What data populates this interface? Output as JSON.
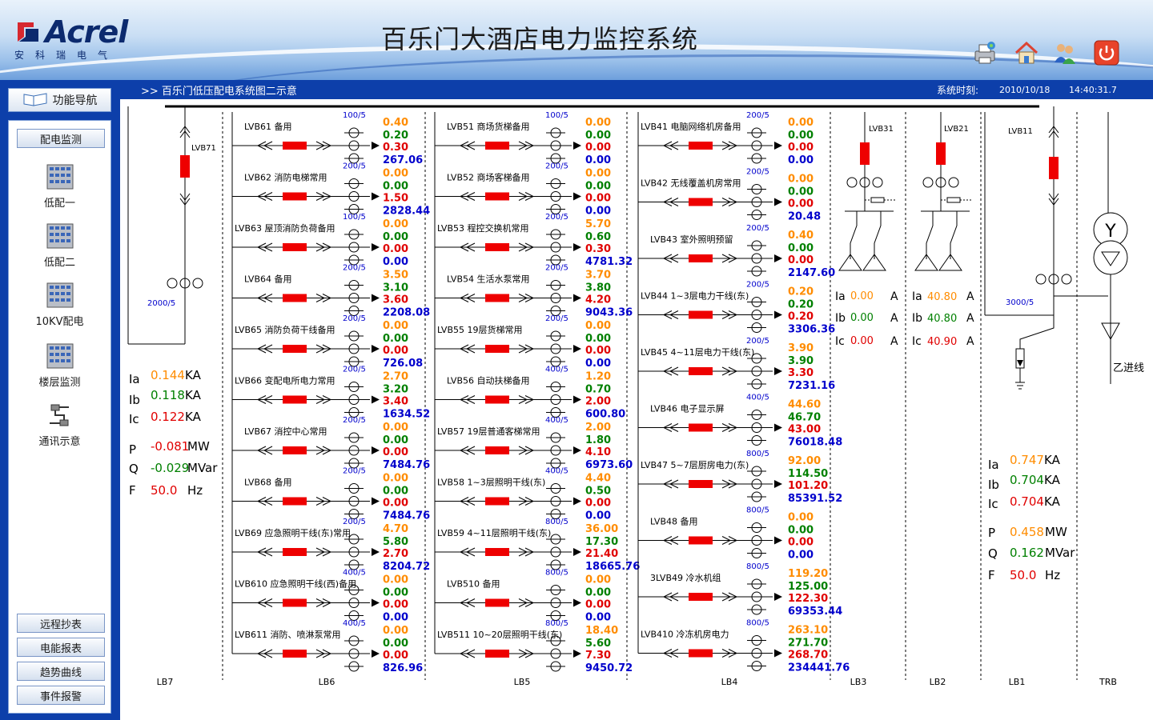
{
  "header": {
    "title": "百乐门大酒店电力监控系统",
    "logo_text": "Acrel",
    "logo_sub": "安科瑞电气",
    "toolbar_icons": [
      "printer-icon",
      "home-icon",
      "users-icon",
      "power-icon"
    ]
  },
  "nav": {
    "breadcrumb": ">>  百乐门低压配电系统图二示意",
    "time_label": "系统时刻:",
    "date": "2010/10/18",
    "time": "14:40:31.7"
  },
  "sidebar": {
    "func_nav_label": "功能导航",
    "section_label": "配电监测",
    "items": [
      {
        "label": "低配一",
        "icon": "switchgear-icon"
      },
      {
        "label": "低配二",
        "icon": "switchgear-icon"
      },
      {
        "label": "10KV配电",
        "icon": "switchgear-icon"
      },
      {
        "label": "楼层监测",
        "icon": "switchgear-icon"
      },
      {
        "label": "通讯示意",
        "icon": "communication-icon"
      }
    ],
    "bottom_buttons": [
      "远程抄表",
      "电能报表",
      "趋势曲线",
      "事件报警"
    ]
  },
  "colors": {
    "ia": "#ff8c00",
    "ib": "#008000",
    "ic": "#e00000",
    "energy": "#0000cc",
    "breaker": "#ee0000",
    "label": "#000000"
  },
  "cabinets": [
    {
      "id": "LB7"
    },
    {
      "id": "LB6"
    },
    {
      "id": "LB5"
    },
    {
      "id": "LB4"
    },
    {
      "id": "LB3"
    },
    {
      "id": "LB2"
    },
    {
      "id": "LB1"
    },
    {
      "id": "TRB"
    }
  ],
  "columns": [
    {
      "feeders": [
        {
          "name": "LVB61 备用",
          "ct": "100/5",
          "ia": "0.40",
          "ib": "0.20",
          "ic": "0.30",
          "e": "267.06"
        },
        {
          "name": "LVB62 消防电梯常用",
          "ct": "200/5",
          "ia": "0.00",
          "ib": "0.00",
          "ic": "1.50",
          "e": "2828.44"
        },
        {
          "name": "LVB63 屋顶消防负荷备用",
          "ct": "100/5",
          "ia": "0.00",
          "ib": "0.00",
          "ic": "0.00",
          "e": "0.00"
        },
        {
          "name": "LVB64 备用",
          "ct": "200/5",
          "ia": "3.50",
          "ib": "3.10",
          "ic": "3.60",
          "e": "2208.08"
        },
        {
          "name": "LVB65 消防负荷干线备用",
          "ct": "200/5",
          "ia": "0.00",
          "ib": "0.00",
          "ic": "0.00",
          "e": "726.08"
        },
        {
          "name": "LVB66 变配电所电力常用",
          "ct": "200/5",
          "ia": "2.70",
          "ib": "3.20",
          "ic": "3.40",
          "e": "1634.52"
        },
        {
          "name": "LVB67 消控中心常用",
          "ct": "200/5",
          "ia": "0.00",
          "ib": "0.00",
          "ic": "0.00",
          "e": "7484.76"
        },
        {
          "name": "LVB68 备用",
          "ct": "200/5",
          "ia": "0.00",
          "ib": "0.00",
          "ic": "0.00",
          "e": "7484.76"
        },
        {
          "name": "LVB69 应急照明干线(东)常用",
          "ct": "200/5",
          "ia": "4.70",
          "ib": "5.80",
          "ic": "2.70",
          "e": "8204.72"
        },
        {
          "name": "LVB610 应急照明干线(西)备用",
          "ct": "400/5",
          "ia": "0.00",
          "ib": "0.00",
          "ic": "0.00",
          "e": "0.00"
        },
        {
          "name": "LVB611 消防、喷淋泵常用",
          "ct": "400/5",
          "ia": "0.00",
          "ib": "0.00",
          "ic": "0.00",
          "e": "826.96"
        }
      ]
    },
    {
      "feeders": [
        {
          "name": "LVB51 商场货梯备用",
          "ct": "100/5",
          "ia": "0.00",
          "ib": "0.00",
          "ic": "0.00",
          "e": "0.00"
        },
        {
          "name": "LVB52 商场客梯备用",
          "ct": "200/5",
          "ia": "0.00",
          "ib": "0.00",
          "ic": "0.00",
          "e": "0.00"
        },
        {
          "name": "LVB53 程控交换机常用",
          "ct": "200/5",
          "ia": "5.70",
          "ib": "0.60",
          "ic": "0.30",
          "e": "4781.32"
        },
        {
          "name": "LVB54 生活水泵常用",
          "ct": "200/5",
          "ia": "3.70",
          "ib": "3.80",
          "ic": "4.20",
          "e": "9043.36"
        },
        {
          "name": "LVB55 19层货梯常用",
          "ct": "200/5",
          "ia": "0.00",
          "ib": "0.00",
          "ic": "0.00",
          "e": "0.00"
        },
        {
          "name": "LVB56 自动扶梯备用",
          "ct": "400/5",
          "ia": "1.20",
          "ib": "0.70",
          "ic": "2.00",
          "e": "600.80"
        },
        {
          "name": "LVB57 19层普通客梯常用",
          "ct": "400/5",
          "ia": "2.00",
          "ib": "1.80",
          "ic": "4.10",
          "e": "6973.60"
        },
        {
          "name": "LVB58 1~3层照明干线(东)",
          "ct": "400/5",
          "ia": "4.40",
          "ib": "0.50",
          "ic": "0.00",
          "e": "0.00"
        },
        {
          "name": "LVB59 4~11层照明干线(东)",
          "ct": "800/5",
          "ia": "36.00",
          "ib": "17.30",
          "ic": "21.40",
          "e": "18665.76"
        },
        {
          "name": "LVB510 备用",
          "ct": "800/5",
          "ia": "0.00",
          "ib": "0.00",
          "ic": "0.00",
          "e": "0.00"
        },
        {
          "name": "LVB511 10~20层照明干线(东)",
          "ct": "800/5",
          "ia": "18.40",
          "ib": "5.60",
          "ic": "7.30",
          "e": "9450.72"
        }
      ]
    },
    {
      "feeders": [
        {
          "name": "LVB41 电脑网络机房备用",
          "ct": "200/5",
          "ia": "0.00",
          "ib": "0.00",
          "ic": "0.00",
          "e": "0.00"
        },
        {
          "name": "LVB42 无线覆盖机房常用",
          "ct": "200/5",
          "ia": "0.00",
          "ib": "0.00",
          "ic": "0.00",
          "e": "20.48"
        },
        {
          "name": "LVB43 室外照明预留",
          "ct": "200/5",
          "ia": "0.40",
          "ib": "0.00",
          "ic": "0.00",
          "e": "2147.60"
        },
        {
          "name": "LVB44 1~3层电力干线(东)",
          "ct": "200/5",
          "ia": "0.20",
          "ib": "0.20",
          "ic": "0.20",
          "e": "3306.36"
        },
        {
          "name": "LVB45 4~11层电力干线(东)",
          "ct": "200/5",
          "ia": "3.90",
          "ib": "3.90",
          "ic": "3.30",
          "e": "7231.16"
        },
        {
          "name": "LVB46 电子显示屏",
          "ct": "400/5",
          "ia": "44.60",
          "ib": "46.70",
          "ic": "43.00",
          "e": "76018.48"
        },
        {
          "name": "LVB47 5~7层厨房电力(东)",
          "ct": "800/5",
          "ia": "92.00",
          "ib": "114.50",
          "ic": "101.20",
          "e": "85391.52"
        },
        {
          "name": "LVB48 备用",
          "ct": "800/5",
          "ia": "0.00",
          "ib": "0.00",
          "ic": "0.00",
          "e": "0.00"
        },
        {
          "name": "3LVB49 冷水机组",
          "ct": "800/5",
          "ia": "119.20",
          "ib": "125.00",
          "ic": "122.30",
          "e": "69353.44"
        },
        {
          "name": "LVB410 冷冻机房电力",
          "ct": "800/5",
          "ia": "263.10",
          "ib": "271.70",
          "ic": "268.70",
          "e": "234441.76"
        }
      ]
    }
  ],
  "lb7": {
    "breaker": "LVB71",
    "ct": "2000/5",
    "ia": "0.144",
    "ib": "0.118",
    "ic": "0.122",
    "p": "-0.081",
    "q": "-0.029",
    "f": "50.0",
    "unit_a": "KA",
    "unit_p": "MW",
    "unit_q": "MVar",
    "unit_f": "Hz"
  },
  "lb3": {
    "breaker": "LVB31",
    "ia": "0.00",
    "ib": "0.00",
    "ic": "0.00",
    "unit": "A"
  },
  "lb2": {
    "breaker": "LVB21",
    "ia": "40.80",
    "ib": "40.80",
    "ic": "40.90",
    "unit": "A"
  },
  "lb1": {
    "breaker": "LVB11",
    "ct": "3000/5",
    "ia": "0.747",
    "ib": "0.704",
    "ic": "0.704",
    "p": "0.458",
    "q": "0.162",
    "f": "50.0",
    "unit_a": "KA",
    "unit_p": "MW",
    "unit_q": "MVar",
    "unit_f": "Hz"
  },
  "trb": {
    "incoming": "乙进线"
  },
  "labels": {
    "ia": "Ia",
    "ib": "Ib",
    "ic": "Ic",
    "p": "P",
    "q": "Q",
    "f": "F"
  }
}
